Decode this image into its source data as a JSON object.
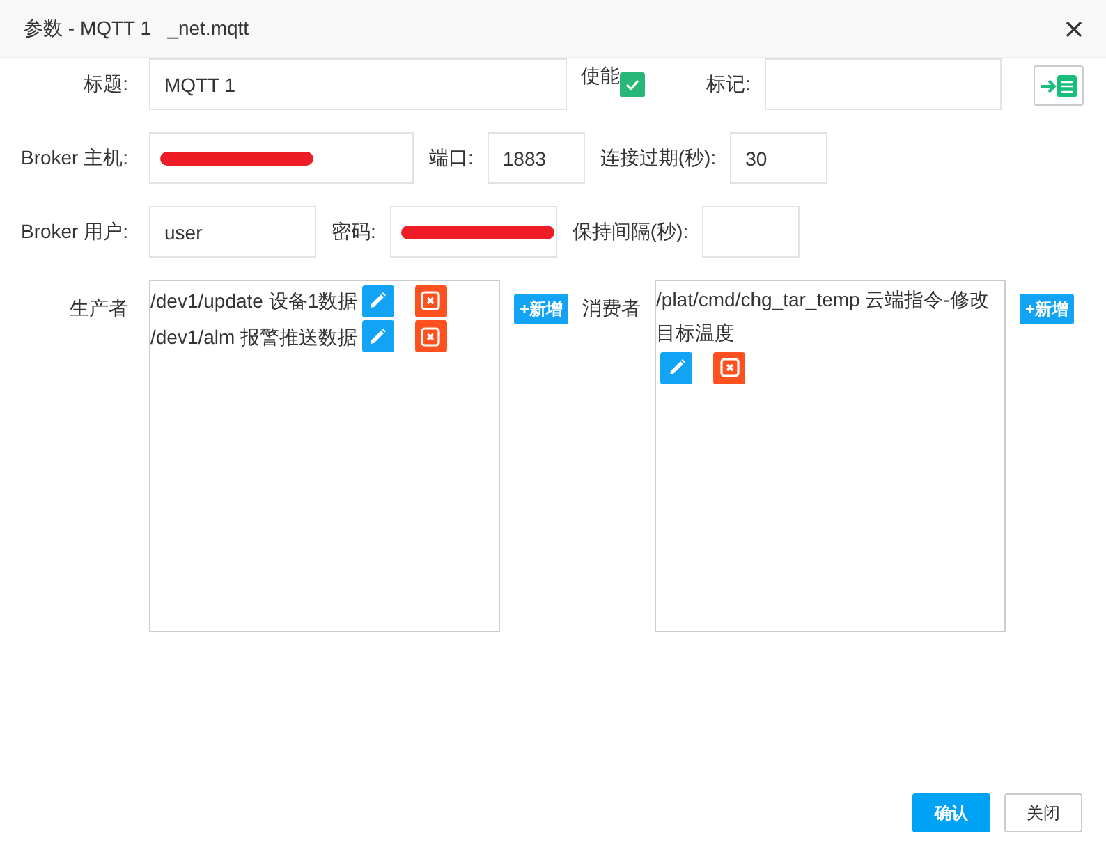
{
  "window": {
    "title": "参数 - MQTT 1   _net.mqtt"
  },
  "form": {
    "title": {
      "label": "标题:",
      "value": "MQTT 1"
    },
    "enable": {
      "label": "使能",
      "checked": true
    },
    "tag": {
      "label": "标记:"
    },
    "broker_host": {
      "label": "Broker 主机:",
      "redacted": true
    },
    "port": {
      "label": "端口:",
      "value": "1883"
    },
    "timeout": {
      "label": "连接过期(秒):",
      "value": "30"
    },
    "broker_user": {
      "label": "Broker 用户:",
      "value": "user"
    },
    "password": {
      "label": "密码:",
      "redacted": true
    },
    "keepalive": {
      "label": "保持间隔(秒):"
    }
  },
  "producers": {
    "label": "生产者",
    "add_button": "+新增",
    "items": [
      {
        "text": "/dev1/update 设备1数据"
      },
      {
        "text": "/dev1/alm 报警推送数据"
      }
    ]
  },
  "consumers": {
    "label": "消费者",
    "add_button": "+新增",
    "items": [
      {
        "text": "/plat/cmd/chg_tar_temp 云端指令-修改目标温度"
      }
    ]
  },
  "buttons": [
    {
      "label": "确认",
      "kind": "primary"
    },
    {
      "label": "关闭",
      "kind": "default"
    }
  ]
}
